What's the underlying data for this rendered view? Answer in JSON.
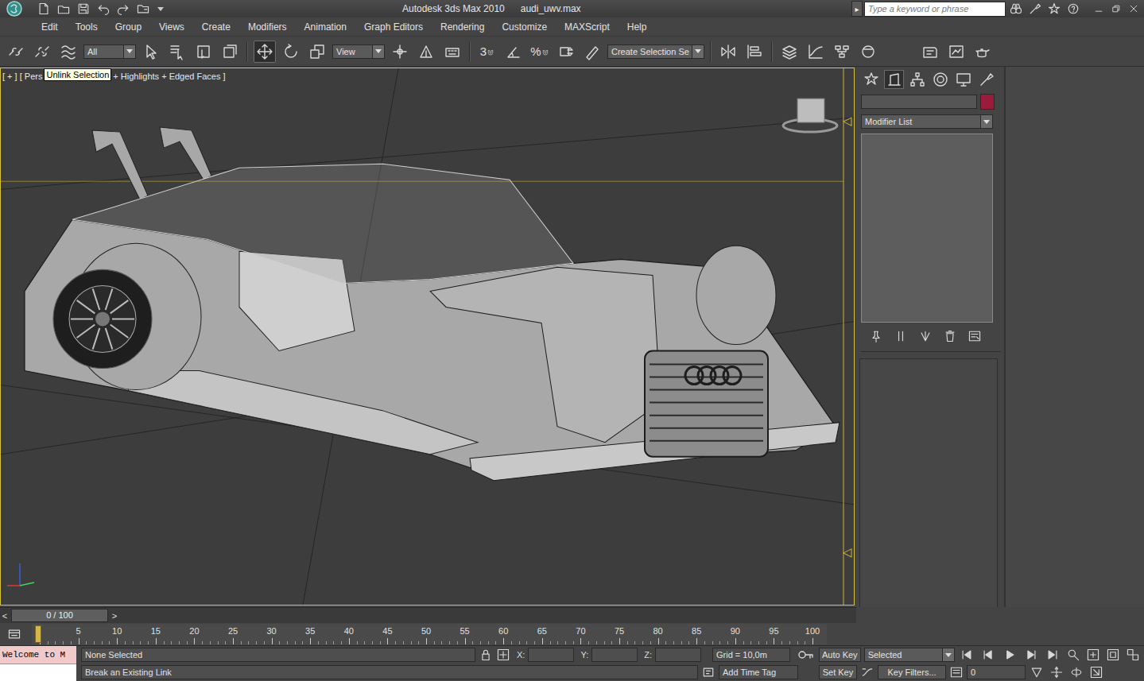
{
  "window": {
    "title": "Autodesk 3ds Max  2010",
    "file": "audi_uwv.max"
  },
  "search": {
    "placeholder": "Type a keyword or phrase",
    "expand": "▸"
  },
  "menu": [
    "Edit",
    "Tools",
    "Group",
    "Views",
    "Create",
    "Modifiers",
    "Animation",
    "Graph Editors",
    "Rendering",
    "Customize",
    "MAXScript",
    "Help"
  ],
  "toolbar": {
    "selection_filter": "All",
    "reference_coord": "View",
    "named_selection": "Create Selection Se",
    "snap_toggle": "3",
    "percent_snap": "%",
    "transform_tools": [
      {
        "selected": true
      },
      {
        "selected": false
      },
      {
        "selected": false
      }
    ]
  },
  "viewport": {
    "label_left": "[ + ] [ Pers",
    "label_right": "+ Highlights + Edged Faces ]",
    "active": true
  },
  "tooltip": "Unlink Selection",
  "command_panel": {
    "tabs": [
      {
        "selected": false
      },
      {
        "selected": true
      },
      {
        "selected": false
      },
      {
        "selected": false
      },
      {
        "selected": false
      },
      {
        "selected": false
      }
    ],
    "object_color": "#9b1b3a",
    "modifier_list": "Modifier List"
  },
  "time_slider": {
    "position": "0 / 100",
    "prev": "<",
    "next": ">",
    "level": 0
  },
  "trackbar": {
    "ticks": [
      "5",
      "10",
      "15",
      "20",
      "25",
      "30",
      "35",
      "40",
      "45",
      "50",
      "55",
      "60",
      "65",
      "70",
      "75",
      "80",
      "85",
      "90",
      "95",
      "100"
    ],
    "marker_level": 0
  },
  "status": {
    "listener": "Welcome to M",
    "selection": "None Selected",
    "prompt": "Break an Existing Link",
    "x_label": "X:",
    "y_label": "Y:",
    "z_label": "Z:",
    "grid": "Grid = 10,0m",
    "add_time_tag": "Add Time Tag",
    "auto_key": "Auto Key",
    "set_key": "Set Key",
    "key_mode": "Selected",
    "key_filters": "Key Filters...",
    "frame": "0"
  }
}
